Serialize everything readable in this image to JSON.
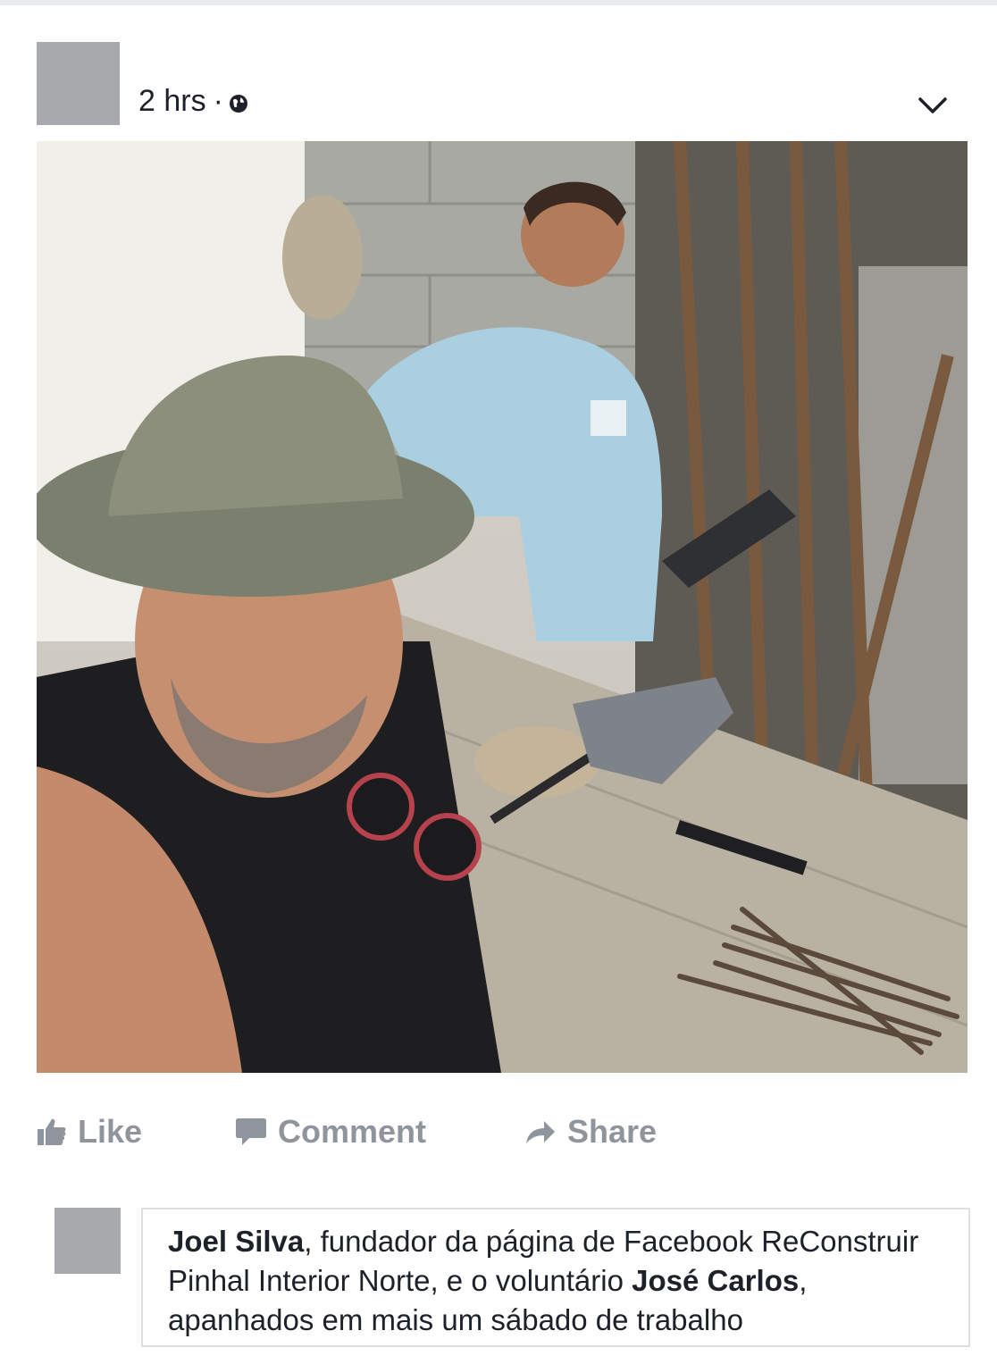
{
  "post": {
    "time": "2 hrs",
    "separator": "·",
    "privacy_icon": "globe-icon",
    "menu_icon": "chevron-down-icon"
  },
  "photo": {
    "description_icon": "photo-image"
  },
  "actions": {
    "like_label": "Like",
    "comment_label": "Comment",
    "share_label": "Share"
  },
  "comment": {
    "name1": "Joel Silva",
    "text1": ", fundador da página de Facebook ReConstruir Pinhal Interior Norte, e o voluntário ",
    "name2": "José Carlos",
    "text2": ", apanhados em mais um sábado de trabalho"
  },
  "colors": {
    "action_gray": "#90949c",
    "avatar_gray": "#a7a9ac",
    "text": "#1d2129"
  }
}
